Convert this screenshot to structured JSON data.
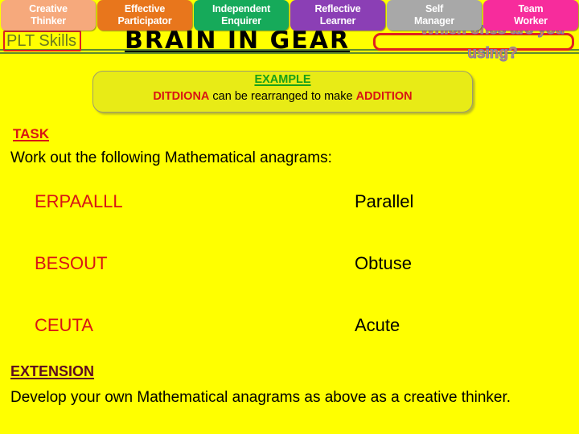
{
  "page": {
    "background_color": "#FFFF00",
    "title": "BRAIN IN GEAR",
    "plt_skills_label": "PLT Skills",
    "overlay_question": "Which ones are you using?"
  },
  "plt_badges": [
    {
      "line1": "Creative",
      "line2": "Thinker",
      "color": "#F6A97C"
    },
    {
      "line1": "Effective",
      "line2": "Participator",
      "color": "#E8761C"
    },
    {
      "line1": "Independent",
      "line2": "Enquirer",
      "color": "#16AA5A"
    },
    {
      "line1": "Reflective",
      "line2": "Learner",
      "color": "#8B3FB5"
    },
    {
      "line1": "Self",
      "line2": "Manager",
      "color": "#A8A8A8"
    },
    {
      "line1": "Team",
      "line2": "Worker",
      "color": "#F72C9C"
    }
  ],
  "example": {
    "heading": "EXAMPLE",
    "anagram": "DITDIONA",
    "connector": " can be rearranged to make ",
    "answer": "ADDITION"
  },
  "task": {
    "heading": "TASK",
    "instruction": "Work out the following Mathematical anagrams:",
    "items": [
      {
        "clue": "ERPAALLL",
        "solution": "Parallel"
      },
      {
        "clue": "BESOUT",
        "solution": "Obtuse"
      },
      {
        "clue": "CEUTA",
        "solution": "Acute"
      }
    ]
  },
  "extension": {
    "heading": "EXTENSION",
    "body": "Develop your own Mathematical anagrams as above as a creative thinker."
  },
  "colors": {
    "background": "#FFFF00",
    "clue_red": "#D81414",
    "task_red": "#D81414",
    "example_green": "#18A018",
    "extension_maroon": "#5E0B20",
    "plt_label_green": "#6B7A20",
    "box_red": "#E02020",
    "rule_green": "#5E8B2E",
    "example_box_bg": "#E8EB16"
  }
}
